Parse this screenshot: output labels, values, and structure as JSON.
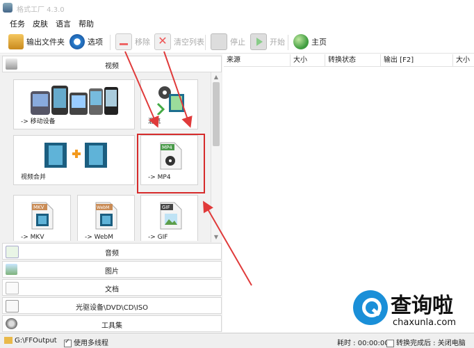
{
  "window": {
    "title": "格式工厂 4.3.0"
  },
  "menu": [
    "任务",
    "皮肤",
    "语言",
    "帮助"
  ],
  "toolbar": {
    "output_folder": "输出文件夹",
    "options": "选项",
    "remove": "移除",
    "clear_list": "清空列表",
    "stop": "停止",
    "start": "开始",
    "home": "主页"
  },
  "categories": {
    "video": "视频",
    "audio": "音频",
    "image": "图片",
    "document": "文档",
    "disc": "光驱设备\\DVD\\CD\\ISO",
    "tools": "工具集"
  },
  "tiles": [
    {
      "label": "-> 移动设备"
    },
    {
      "label": "混流"
    },
    {
      "label": "视频合并"
    },
    {
      "label": "-> MP4"
    },
    {
      "label": "-> MKV"
    },
    {
      "label": "-> WebM"
    },
    {
      "label": "-> GIF"
    }
  ],
  "icon_texts": {
    "mp4": "MP4",
    "mkv": "MKV",
    "webm": "WebM",
    "gif": "GIF"
  },
  "file_table": {
    "columns": [
      "来源",
      "大小",
      "转换状态",
      "输出 [F2]",
      "大小"
    ]
  },
  "status": {
    "path": "G:\\FFOutput",
    "multithread": "使用多线程",
    "elapsed": "耗时 : 00:00:00",
    "after_convert": "转换完成后 : 关闭电脑"
  },
  "watermark": {
    "title": "查询啦",
    "site": "chaxunla.com"
  },
  "colors": {
    "highlight": "#d62b2b",
    "watermark_blue": "#1a8fd8"
  }
}
